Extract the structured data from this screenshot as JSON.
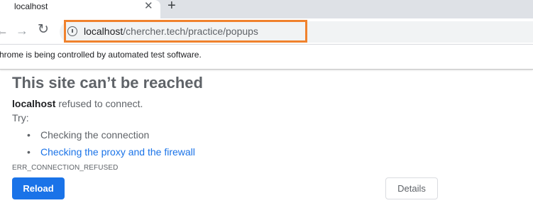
{
  "tab": {
    "title": "localhost",
    "close_glyph": "✕",
    "new_tab_glyph": "+"
  },
  "toolbar": {
    "back_glyph": "←",
    "forward_glyph": "→",
    "reload_glyph": "↻",
    "url_host": "localhost",
    "url_path": "/chercher.tech/practice/popups"
  },
  "infobar": {
    "text": "hrome is being controlled by automated test software."
  },
  "error": {
    "title": "This site can’t be reached",
    "host": "localhost",
    "message": " refused to connect.",
    "try_label": "Try:",
    "bullet": "•",
    "suggestions": [
      "Checking the connection",
      "Checking the proxy and the firewall"
    ],
    "code": "ERR_CONNECTION_REFUSED",
    "reload_label": "Reload",
    "details_label": "Details"
  },
  "colors": {
    "highlight": "#f0822d",
    "primary_button": "#1a73e8",
    "link": "#1a73e8",
    "tabstrip": "#dee1e6"
  }
}
